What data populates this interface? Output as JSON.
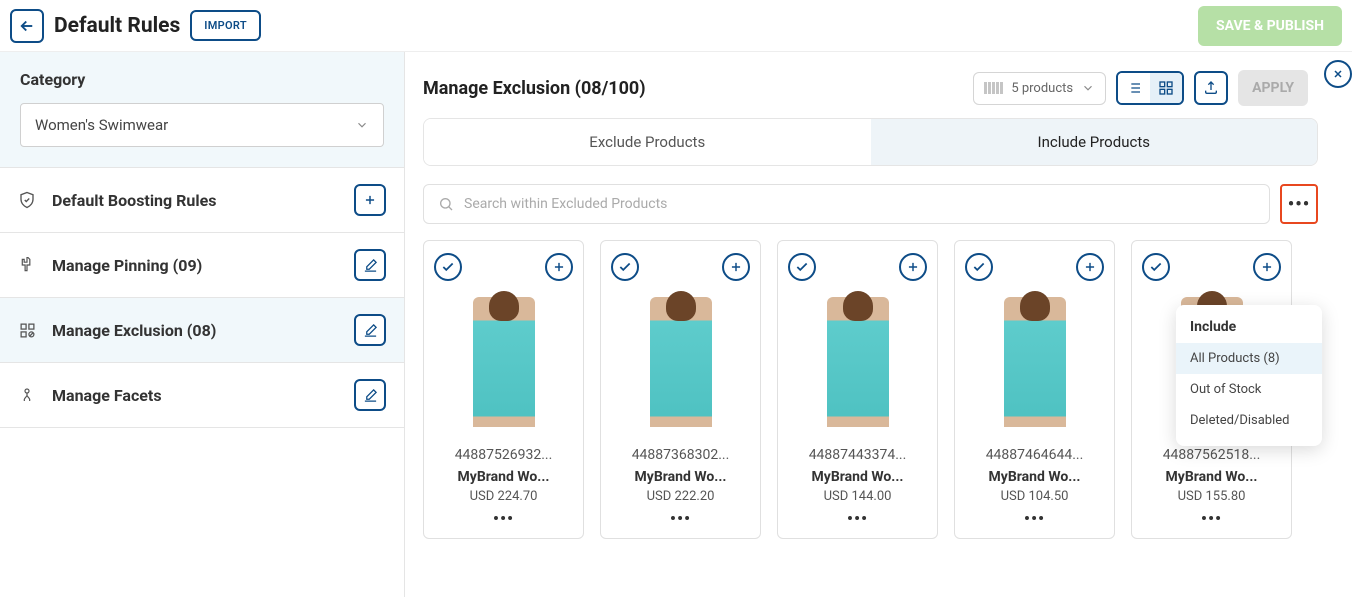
{
  "header": {
    "page_title": "Default Rules",
    "import_label": "IMPORT",
    "save_publish_label": "SAVE & PUBLISH"
  },
  "sidebar": {
    "category_label": "Category",
    "category_value": "Women's Swimwear",
    "items": [
      {
        "label": "Default Boosting Rules",
        "action": "plus"
      },
      {
        "label": "Manage Pinning (09)",
        "action": "edit"
      },
      {
        "label": "Manage Exclusion (08)",
        "action": "edit",
        "active": true
      },
      {
        "label": "Manage Facets",
        "action": "edit"
      }
    ]
  },
  "content": {
    "title": "Manage Exclusion (08/100)",
    "zoom_label": "5 products",
    "apply_label": "APPLY",
    "tabs": {
      "exclude": "Exclude Products",
      "include": "Include Products"
    },
    "search_placeholder": "Search within Excluded Products"
  },
  "dropdown": {
    "header": "Include",
    "items": [
      "All Products (8)",
      "Out of Stock",
      "Deleted/Disabled"
    ]
  },
  "products": [
    {
      "sku": "44887526932...",
      "brand": "MyBrand Wo...",
      "price": "USD 224.70"
    },
    {
      "sku": "44887368302...",
      "brand": "MyBrand Wo...",
      "price": "USD 222.20"
    },
    {
      "sku": "44887443374...",
      "brand": "MyBrand Wo...",
      "price": "USD 144.00"
    },
    {
      "sku": "44887464644...",
      "brand": "MyBrand Wo...",
      "price": "USD 104.50"
    },
    {
      "sku": "44887562518...",
      "brand": "MyBrand Wo...",
      "price": "USD 155.80"
    }
  ]
}
